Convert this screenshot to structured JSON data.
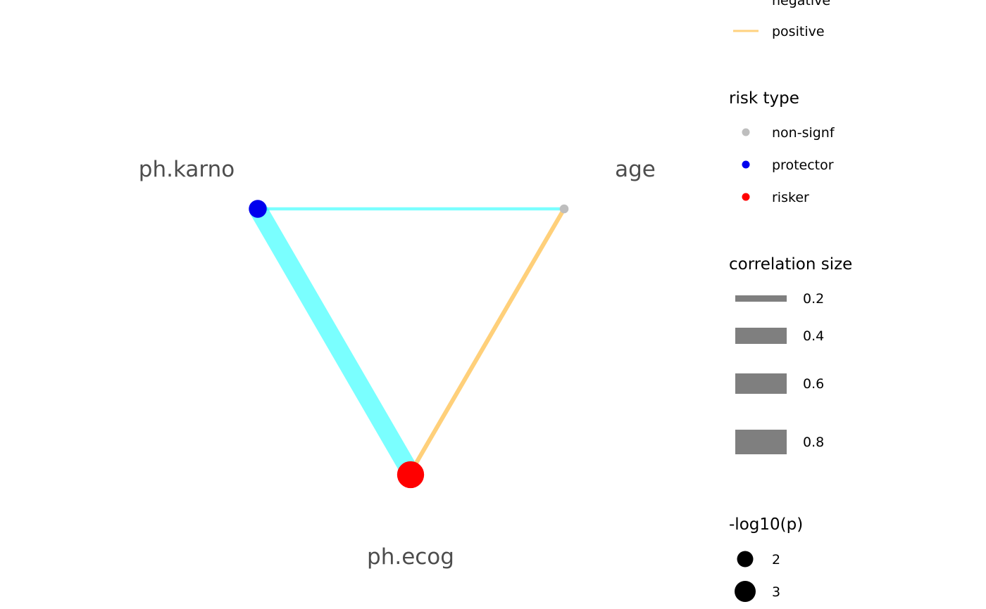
{
  "nodes": [
    {
      "id": "age",
      "label": "age",
      "risk_type": "non-signf",
      "neg_log10_p": 0.5
    },
    {
      "id": "ph.karno",
      "label": "ph.karno",
      "risk_type": "protector",
      "neg_log10_p": 1.9
    },
    {
      "id": "ph.ecog",
      "label": "ph.ecog",
      "risk_type": "risker",
      "neg_log10_p": 3.3
    }
  ],
  "edges": [
    {
      "from": "ph.karno",
      "to": "age",
      "correlation": 0.14,
      "direction": "negative"
    },
    {
      "from": "ph.karno",
      "to": "ph.ecog",
      "correlation": 0.81,
      "direction": "negative"
    },
    {
      "from": "age",
      "to": "ph.ecog",
      "correlation": 0.19,
      "direction": "positive"
    }
  ],
  "colors": {
    "negative": "#00ffff",
    "positive": "#ffa500",
    "non-signf": "#bebebe",
    "protector": "#0000ee",
    "risker": "#ff0000",
    "size_key": "#7f7f7f"
  },
  "legend": {
    "direction": {
      "items": [
        {
          "label": "negative",
          "key": "negative"
        },
        {
          "label": "positive",
          "key": "positive"
        }
      ]
    },
    "risk_type": {
      "title": "risk type",
      "items": [
        {
          "label": "non-signf",
          "key": "non-signf"
        },
        {
          "label": "protector",
          "key": "protector"
        },
        {
          "label": "risker",
          "key": "risker"
        }
      ]
    },
    "correlation_size": {
      "title": "correlation size",
      "items": [
        {
          "label": "0.2",
          "value": 0.2
        },
        {
          "label": "0.4",
          "value": 0.4
        },
        {
          "label": "0.6",
          "value": 0.6
        },
        {
          "label": "0.8",
          "value": 0.8
        }
      ]
    },
    "pvalue": {
      "title": "-log10(p)",
      "items": [
        {
          "label": "2",
          "value": 2
        },
        {
          "label": "3",
          "value": 3
        }
      ]
    }
  }
}
